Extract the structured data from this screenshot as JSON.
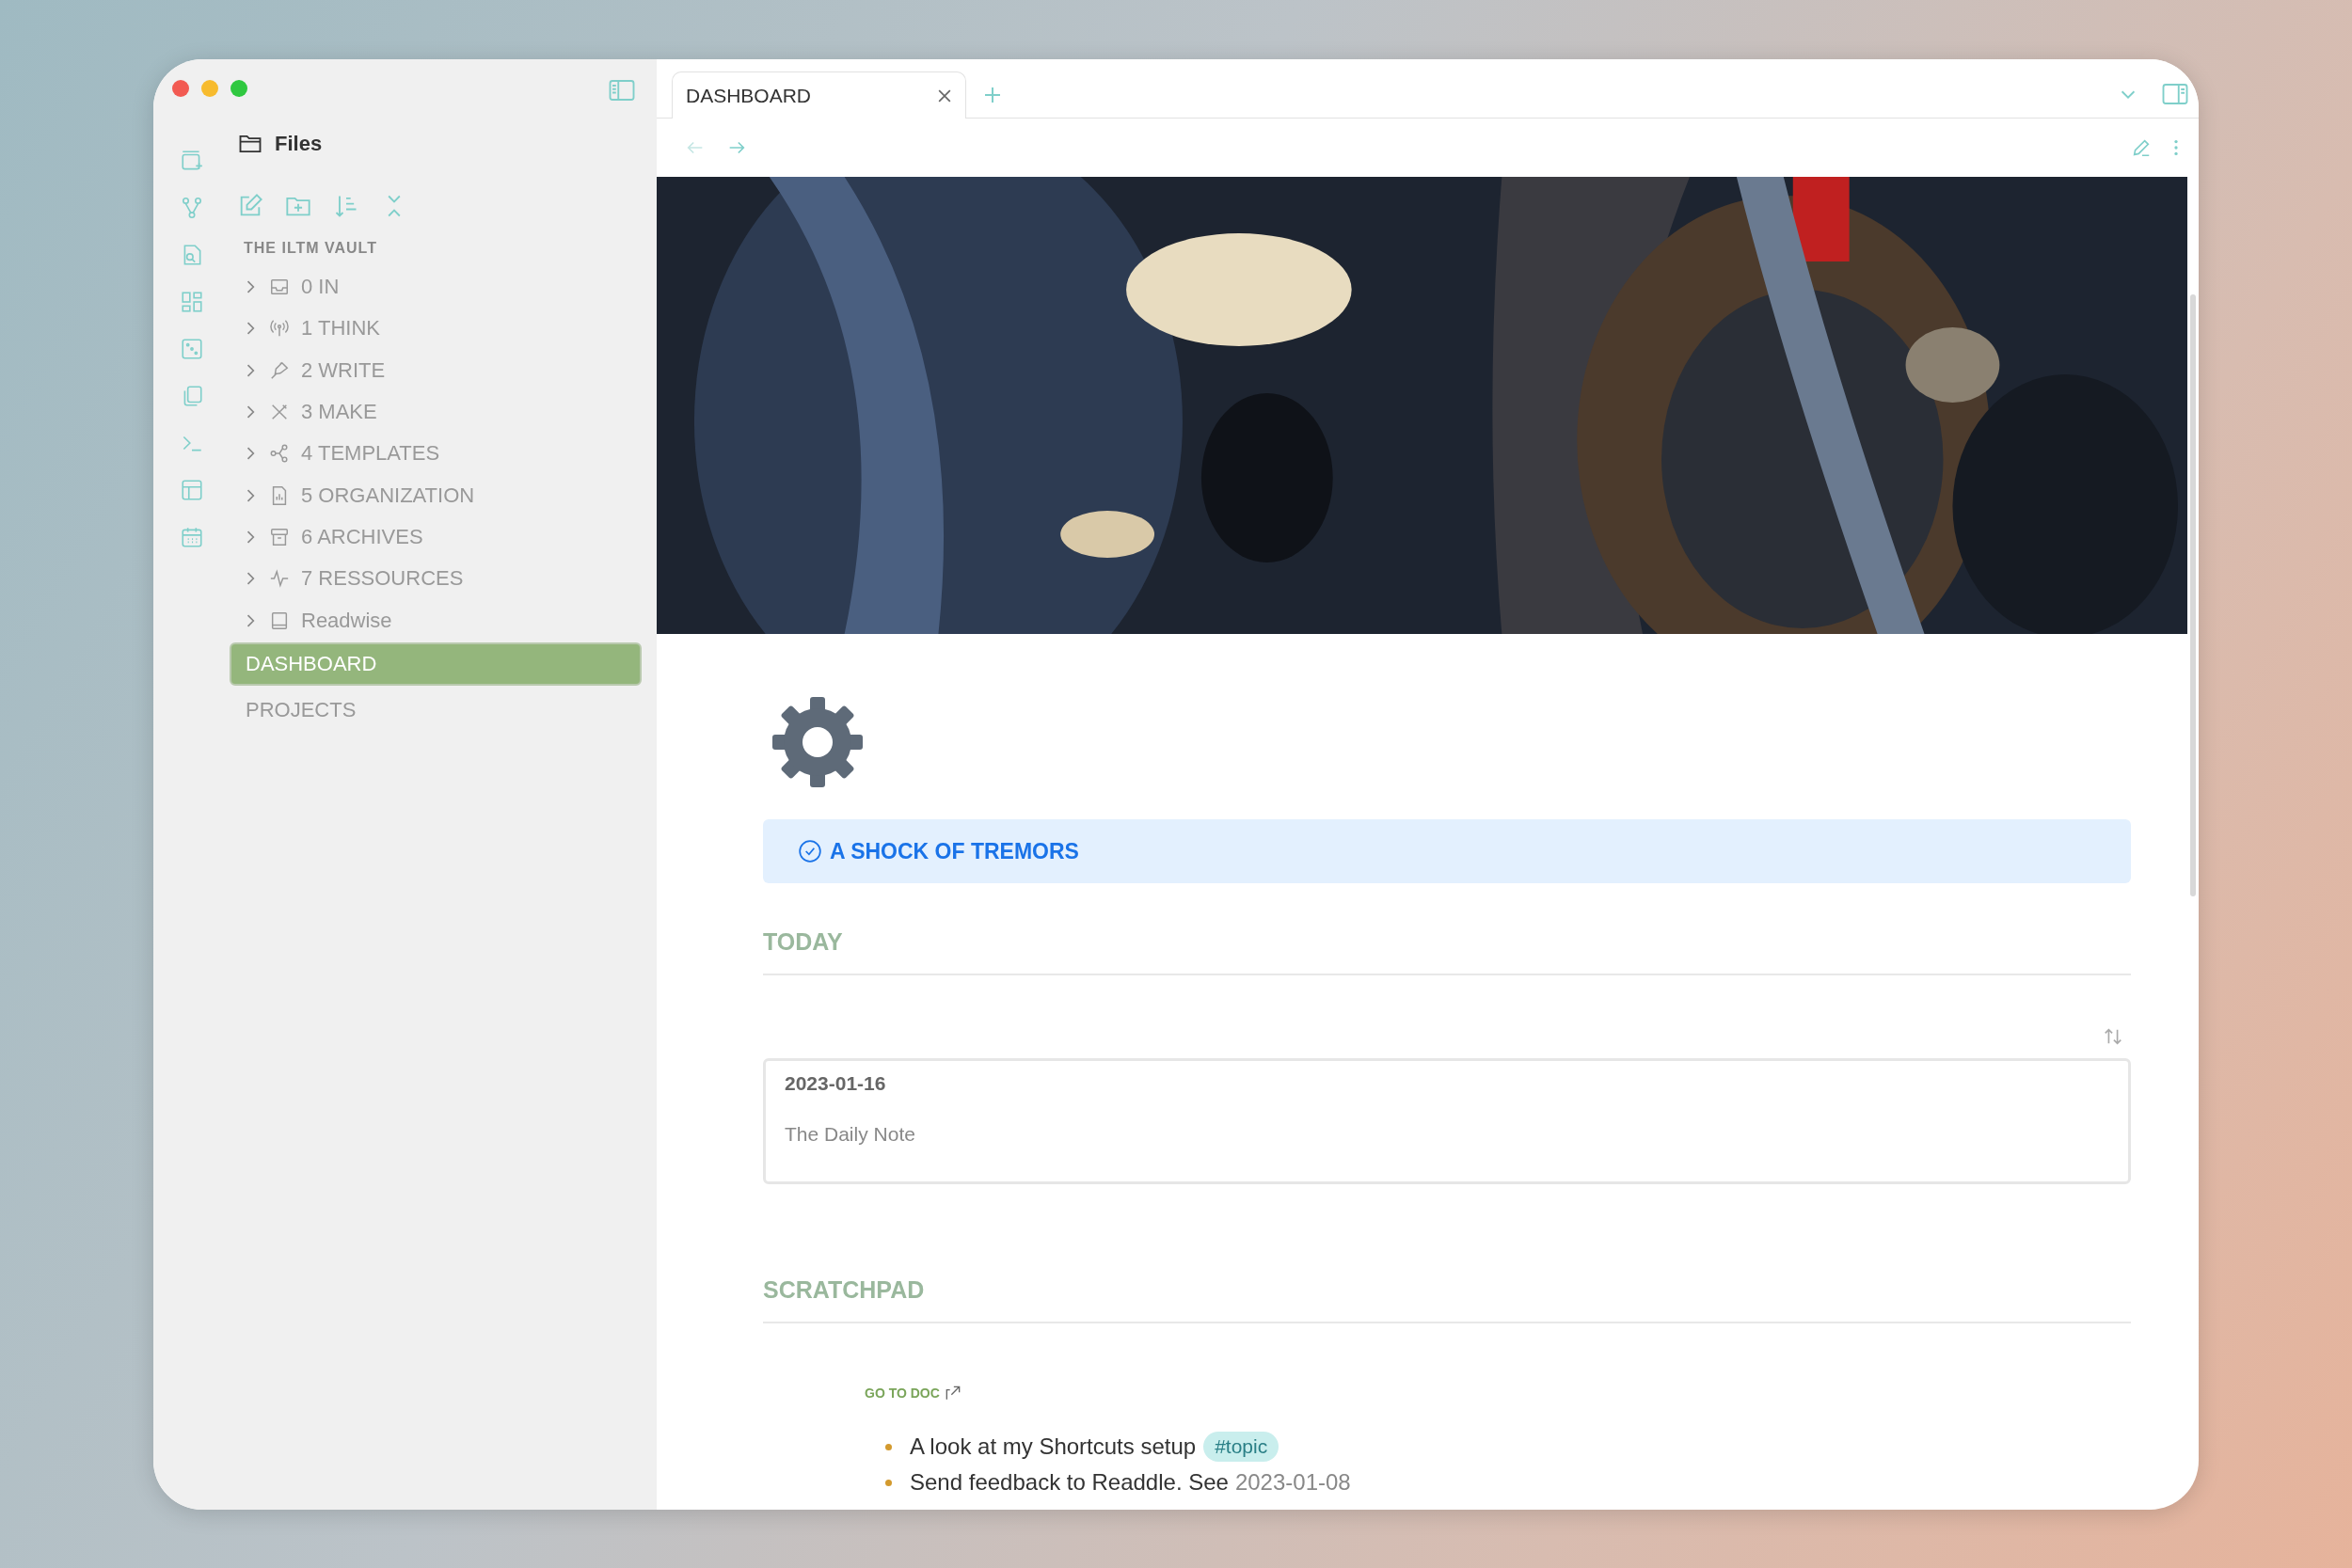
{
  "sidebar": {
    "title": "Files",
    "vault": "THE ILTM VAULT",
    "folders": [
      {
        "label": "0 IN",
        "kind": "inbox",
        "expanded": false
      },
      {
        "label": "1 THINK",
        "kind": "antenna",
        "expanded": false
      },
      {
        "label": "2 WRITE",
        "kind": "pen",
        "expanded": false
      },
      {
        "label": "3 MAKE",
        "kind": "tools",
        "expanded": false
      },
      {
        "label": "4 TEMPLATES",
        "kind": "nodes",
        "expanded": false
      },
      {
        "label": "5 ORGANIZATION",
        "kind": "chart",
        "expanded": false
      },
      {
        "label": "6 ARCHIVES",
        "kind": "archive",
        "expanded": false
      },
      {
        "label": "7 RESSOURCES",
        "kind": "pulse",
        "expanded": false
      },
      {
        "label": "Readwise",
        "kind": "book",
        "expanded": false
      }
    ],
    "files": [
      {
        "label": "DASHBOARD",
        "selected": true
      },
      {
        "label": "PROJECTS",
        "selected": false
      }
    ]
  },
  "tabs": [
    {
      "label": "DASHBOARD",
      "selected": true
    }
  ],
  "note": {
    "callout": "A SHOCK OF TREMORS",
    "today": {
      "heading": "TODAY",
      "card": {
        "date": "2023-01-16",
        "text": "The Daily Note"
      }
    },
    "scratchpad": {
      "heading": "SCRATCHPAD",
      "link": "GO TO DOC",
      "items": [
        {
          "text": "A look at my Shortcuts setup",
          "tag": "#topic"
        },
        {
          "text": "Send feedback to Readdle. See",
          "date": "2023-01-08"
        }
      ]
    }
  }
}
